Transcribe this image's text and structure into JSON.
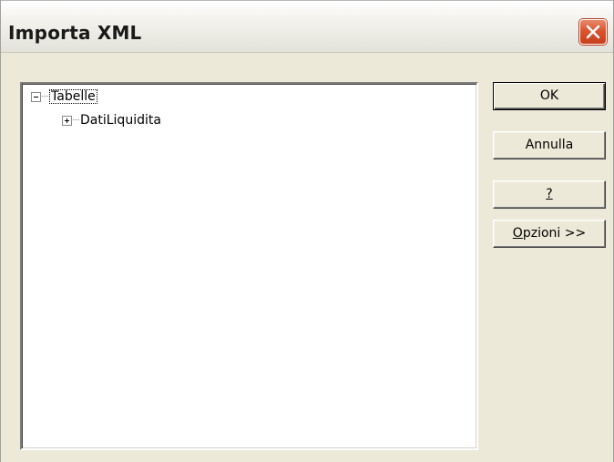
{
  "window": {
    "title": "Importa XML",
    "close_icon": "close-icon"
  },
  "tree": {
    "root": {
      "label": "Tabelle",
      "expanded": true,
      "selected": true
    },
    "children": [
      {
        "label": "DatiLiquidita",
        "expanded": false
      }
    ]
  },
  "buttons": {
    "ok": {
      "label": "OK"
    },
    "cancel": {
      "label": "Annulla"
    },
    "help": {
      "mnemonic": "?",
      "rest": ""
    },
    "options": {
      "mnemonic": "O",
      "rest": "pzioni >>"
    }
  },
  "colors": {
    "dialog_bg": "#ece9d8",
    "close_button": "#d9542f",
    "tree_bg": "#ffffff"
  }
}
